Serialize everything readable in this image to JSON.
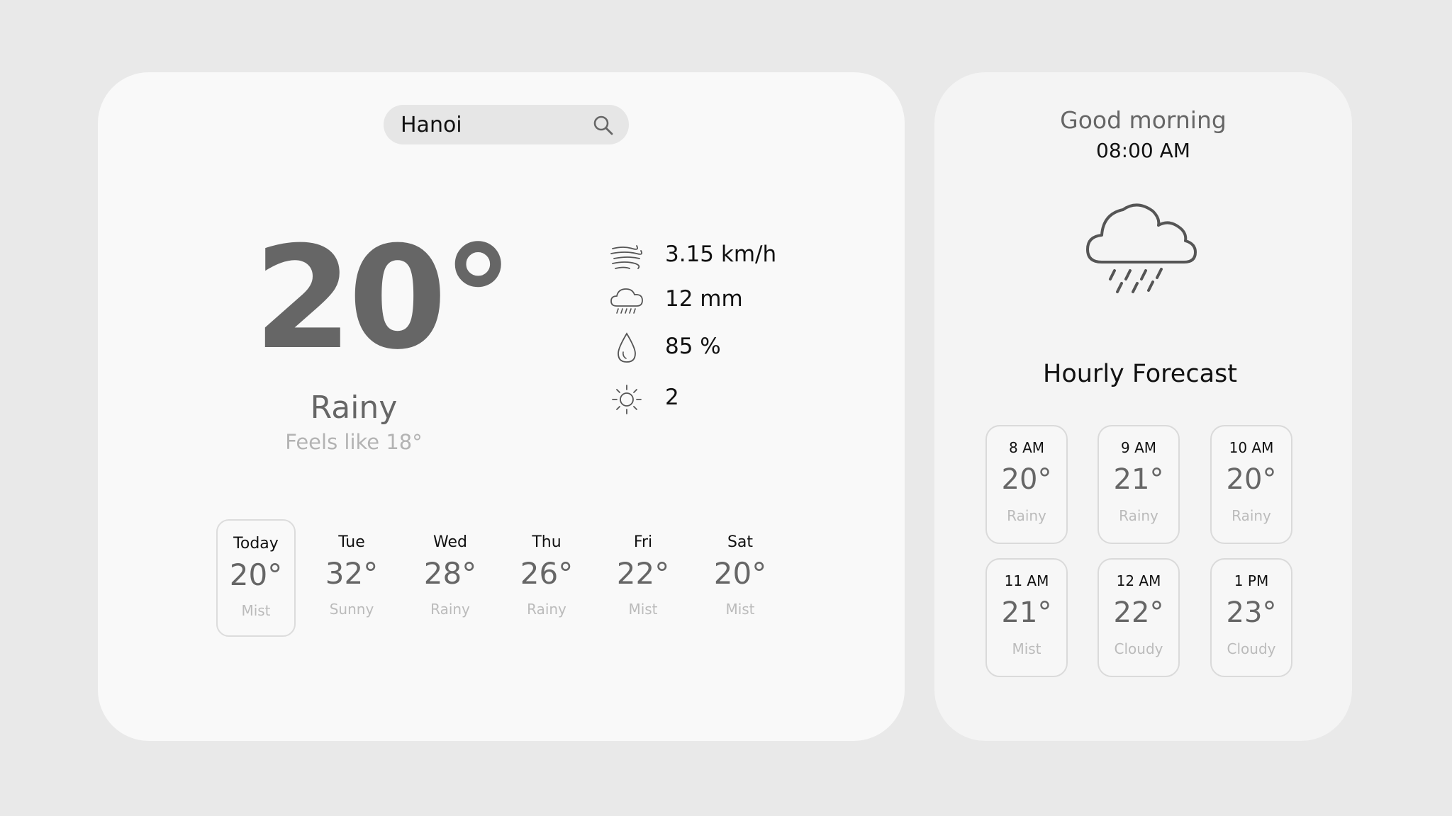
{
  "search": {
    "value": "Hanoi"
  },
  "current": {
    "temperature": "20°",
    "condition": "Rainy",
    "feels_like": "Feels like 18°"
  },
  "stats": {
    "wind": "3.15 km/h",
    "precipitation": "12 mm",
    "humidity": "85 %",
    "uv_index": "2"
  },
  "daily": [
    {
      "day": "Today",
      "temp": "20°",
      "condition": "Mist"
    },
    {
      "day": "Tue",
      "temp": "32°",
      "condition": "Sunny"
    },
    {
      "day": "Wed",
      "temp": "28°",
      "condition": "Rainy"
    },
    {
      "day": "Thu",
      "temp": "26°",
      "condition": "Rainy"
    },
    {
      "day": "Fri",
      "temp": "22°",
      "condition": "Mist"
    },
    {
      "day": "Sat",
      "temp": "20°",
      "condition": "Mist"
    }
  ],
  "side": {
    "greeting": "Good morning",
    "time": "08:00 AM",
    "hourly_title": "Hourly Forecast"
  },
  "hourly": [
    {
      "time": "8 AM",
      "temp": "20°",
      "condition": "Rainy"
    },
    {
      "time": "9 AM",
      "temp": "21°",
      "condition": "Rainy"
    },
    {
      "time": "10 AM",
      "temp": "20°",
      "condition": "Rainy"
    },
    {
      "time": "11 AM",
      "temp": "21°",
      "condition": "Mist"
    },
    {
      "time": "12 AM",
      "temp": "22°",
      "condition": "Cloudy"
    },
    {
      "time": "1 PM",
      "temp": "23°",
      "condition": "Cloudy"
    }
  ],
  "icons": {
    "search": "search-icon",
    "wind": "wind-icon",
    "precipitation": "rain-cloud-icon",
    "humidity": "droplet-icon",
    "uv": "sun-icon",
    "current": "rain-cloud-icon"
  },
  "colors": {
    "background": "#e9e9e9",
    "card": "#f9f9f9",
    "muted_text": "#666666",
    "faint_text": "#bbbbbb"
  }
}
